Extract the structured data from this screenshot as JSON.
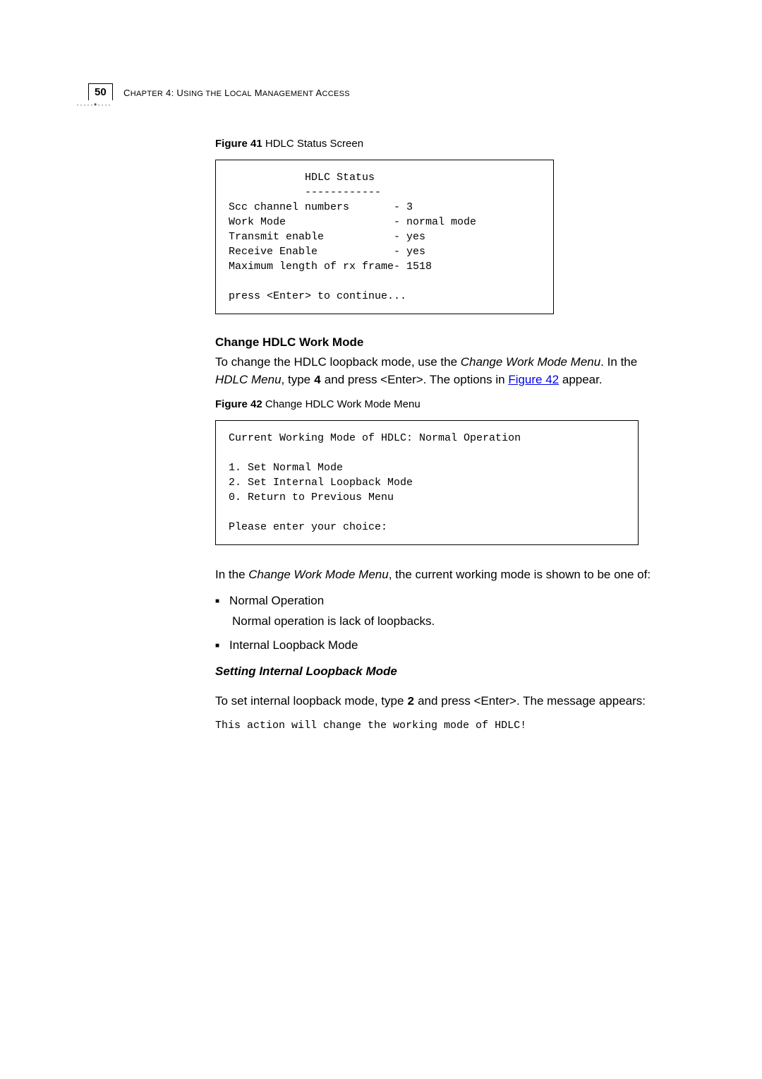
{
  "header": {
    "page_number": "50",
    "chapter_text": "Chapter 4: Using the Local Management Access"
  },
  "figure41": {
    "caption_bold": "Figure 41",
    "caption_rest": "   HDLC Status Screen",
    "code": "            HDLC Status\n            ------------\nScc channel numbers       - 3\nWork Mode                 - normal mode\nTransmit enable           - yes\nReceive Enable            - yes\nMaximum length of rx frame- 1518\n\npress <Enter> to continue..."
  },
  "section1": {
    "heading": "Change HDLC Work Mode",
    "para_part1": "To change the HDLC loopback mode, use the ",
    "para_italic1": "Change Work Mode Menu",
    "para_part2": ". In the ",
    "para_italic2": "HDLC Menu",
    "para_part3": ", type ",
    "para_bold": "4",
    "para_part4": " and press <Enter>. The options in ",
    "para_link": "Figure 42",
    "para_part5": " appear."
  },
  "figure42": {
    "caption_bold": "Figure 42",
    "caption_rest": "   Change HDLC Work Mode Menu",
    "code": "Current Working Mode of HDLC: Normal Operation\n\n1. Set Normal Mode\n2. Set Internal Loopback Mode\n0. Return to Previous Menu\n\nPlease enter your choice:"
  },
  "section2": {
    "para_part1": "In the ",
    "para_italic": "Change Work Mode Menu",
    "para_part2": ", the current working mode is shown to be one of:",
    "bullet1": "Normal Operation",
    "bullet1_sub": "Normal operation is lack of loopbacks.",
    "bullet2": "Internal Loopback Mode"
  },
  "section3": {
    "heading": "Setting Internal Loopback Mode",
    "para_part1": "To set internal loopback mode, type ",
    "para_bold": "2",
    "para_part2": " and press <Enter>. The message appears:",
    "code_line": "This action will change the working mode of HDLC!"
  }
}
